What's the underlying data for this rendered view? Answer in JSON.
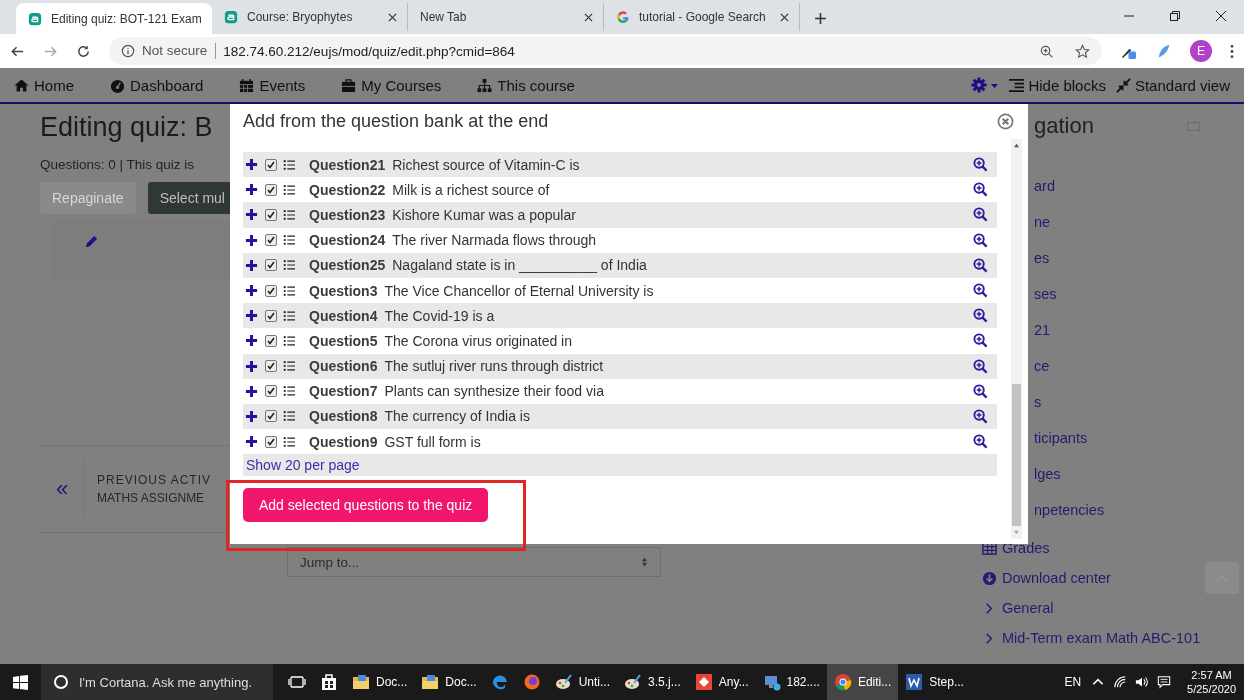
{
  "browser": {
    "tabs": [
      {
        "title": "Editing quiz: BOT-121 Exam",
        "kind": "moodle",
        "selected": true
      },
      {
        "title": "Course: Bryophytes",
        "kind": "moodle",
        "selected": false
      },
      {
        "title": "New Tab",
        "kind": "blank",
        "selected": false
      },
      {
        "title": "tutorial - Google Search",
        "kind": "google",
        "selected": false
      }
    ],
    "security": "Not secure",
    "url": "182.74.60.212/eujs/mod/quiz/edit.php?cmid=864",
    "profile": "E"
  },
  "navbar": {
    "items": [
      {
        "kind": "home",
        "label": "Home"
      },
      {
        "kind": "dashboard",
        "label": "Dashboard"
      },
      {
        "kind": "events",
        "label": "Events"
      },
      {
        "kind": "courses",
        "label": "My Courses"
      },
      {
        "kind": "course",
        "label": "This course"
      }
    ],
    "actions": [
      {
        "kind": "hide",
        "label": "Hide blocks"
      },
      {
        "kind": "standard",
        "label": "Standard view"
      }
    ]
  },
  "page": {
    "title": "Editing quiz: B",
    "info": "Questions: 0 | This quiz is",
    "buttons": [
      {
        "label": "Repaginate",
        "disabled": true
      },
      {
        "label": "Select mul",
        "disabled": false
      }
    ],
    "prev_arrow": "«",
    "prev_label": "PREVIOUS ACTIV",
    "prev_name": "MATHS ASSIGNME",
    "jump": {
      "placeholder": "Jump to..."
    }
  },
  "navigation": {
    "title": "gation",
    "partial_items": [
      "ard",
      "ne",
      "es",
      "ses",
      "21",
      "ce",
      "s",
      "ticipants",
      "lges",
      "npetencies"
    ],
    "items": [
      {
        "kind": "grades",
        "label": "Grades"
      },
      {
        "kind": "download",
        "label": "Download center"
      },
      {
        "kind": "section",
        "label": "General"
      },
      {
        "kind": "section",
        "label": "Mid-Term exam Math ABC-101"
      }
    ]
  },
  "modal": {
    "title": "Add from the question bank at the end",
    "questions": [
      {
        "name": "Question21",
        "text": "Richest source of Vitamin-C is",
        "checked": true
      },
      {
        "name": "Question22",
        "text": "Milk is a richest source of",
        "checked": true
      },
      {
        "name": "Question23",
        "text": "Kishore Kumar was a popular",
        "checked": true
      },
      {
        "name": "Question24",
        "text": "The river Narmada flows through",
        "checked": true
      },
      {
        "name": "Question25",
        "text": "Nagaland state is in __________ of India",
        "checked": true
      },
      {
        "name": "Question3",
        "text": "The Vice Chancellor of Eternal University is",
        "checked": true
      },
      {
        "name": "Question4",
        "text": "The Covid-19 is a",
        "checked": true
      },
      {
        "name": "Question5",
        "text": "The Corona virus originated in",
        "checked": true
      },
      {
        "name": "Question6",
        "text": "The sutluj river runs through district",
        "checked": true
      },
      {
        "name": "Question7",
        "text": "Plants can synthesize their food via",
        "checked": true
      },
      {
        "name": "Question8",
        "text": "The currency of India is",
        "checked": true
      },
      {
        "name": "Question9",
        "text": "GST full form is",
        "checked": true
      }
    ],
    "pager_link": "Show 20 per page",
    "submit": "Add selected questions to the quiz",
    "highlighted": true
  },
  "taskbar": {
    "search": {
      "placeholder": "I'm Cortana. Ask me anything."
    },
    "apps": [
      {
        "kind": "taskview",
        "selected": false
      },
      {
        "kind": "store",
        "selected": false
      },
      {
        "kind": "files",
        "label": "Doc...",
        "selected": false
      },
      {
        "kind": "files",
        "label": "Doc...",
        "selected": false
      },
      {
        "kind": "edge",
        "selected": false
      },
      {
        "kind": "firefox",
        "selected": false
      },
      {
        "kind": "paint",
        "label": "Unti...",
        "selected": false
      },
      {
        "kind": "paint",
        "label": "3.5.j...",
        "selected": false
      },
      {
        "kind": "anydesk",
        "label": "Any...",
        "selected": false
      },
      {
        "kind": "remote",
        "label": "182....",
        "selected": false
      },
      {
        "kind": "chrome",
        "label": "Editi...",
        "selected": true
      },
      {
        "kind": "word",
        "label": "Step...",
        "selected": false
      }
    ],
    "language": "EN",
    "time": "2:57 AM",
    "date": "5/25/2020"
  }
}
